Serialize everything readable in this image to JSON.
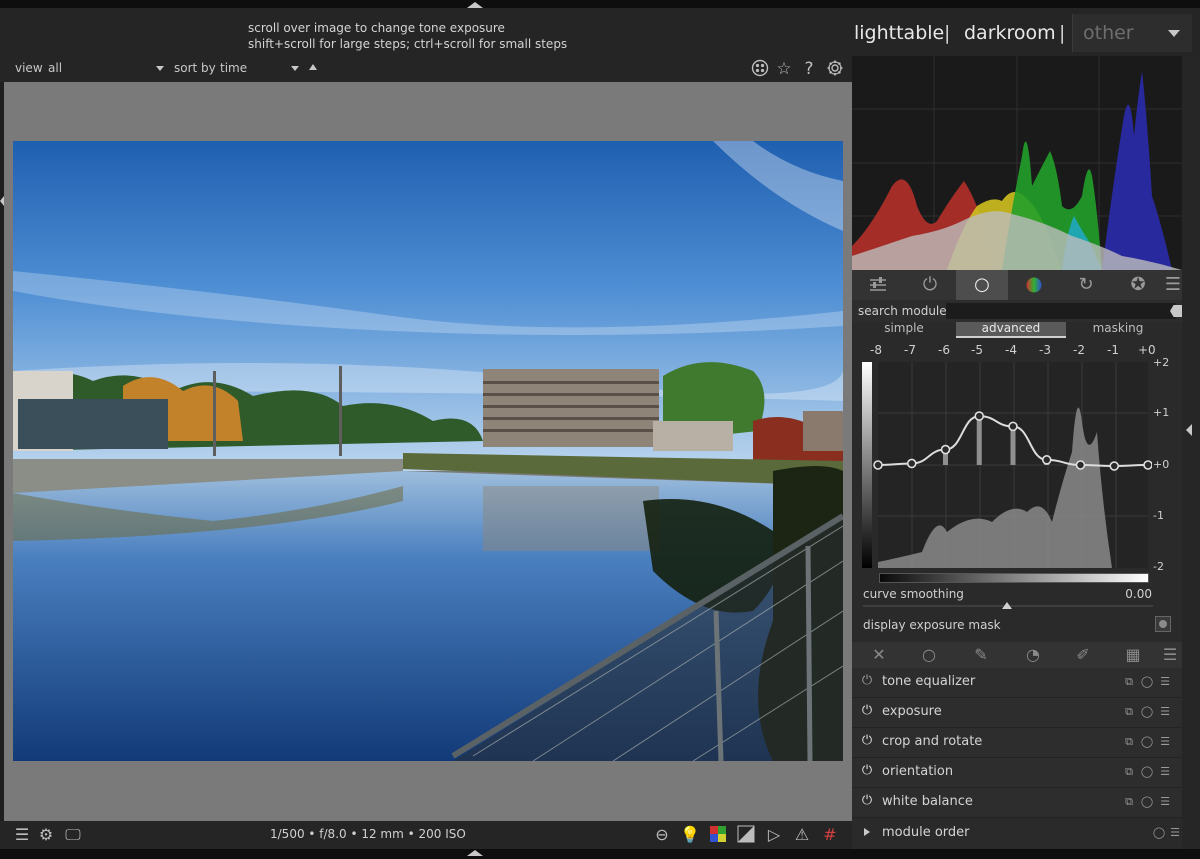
{
  "hint": {
    "line1": "scroll over image to change tone exposure",
    "line2": "shift+scroll for large steps; ctrl+scroll for small steps"
  },
  "views": {
    "lighttable": "lighttable",
    "darkroom": "darkroom",
    "separator": "|",
    "other": "other"
  },
  "filterbar": {
    "view_label": "view",
    "view_value": "all",
    "sort_label": "sort by",
    "sort_value": "time"
  },
  "exif": "1/500 • f/8.0 • 12 mm • 200 ISO",
  "module_search": {
    "label": "search module",
    "value": ""
  },
  "tone_equalizer": {
    "tabs": [
      "simple",
      "advanced",
      "masking"
    ],
    "active_tab": "advanced",
    "ev_ticks": [
      "-8",
      "-7",
      "-6",
      "-5",
      "-4",
      "-3",
      "-2",
      "-1",
      "+0"
    ],
    "y_ticks": [
      "+2",
      "+1",
      "+0",
      "-1",
      "-2"
    ],
    "curve_smoothing_label": "curve smoothing",
    "curve_smoothing_value": "0.00",
    "display_mask_label": "display exposure mask",
    "band_values": [
      0,
      0.03,
      0.3,
      0.95,
      0.75,
      0.1,
      0,
      -0.02,
      0
    ]
  },
  "modules": [
    {
      "name": "tone equalizer"
    },
    {
      "name": "exposure"
    },
    {
      "name": "crop and rotate"
    },
    {
      "name": "orientation"
    },
    {
      "name": "white balance"
    }
  ],
  "module_order_label": "module order",
  "colors": {
    "panel_bg": "#2a2a2a",
    "canvas_bg": "#7a7a7a",
    "hist_red": "#b5302a",
    "hist_green": "#22a02a",
    "hist_blue": "#2a2aa5",
    "hist_yellow": "#d0c020",
    "hist_cyan": "#20a8c0",
    "hist_gray": "#bdbdbd"
  }
}
